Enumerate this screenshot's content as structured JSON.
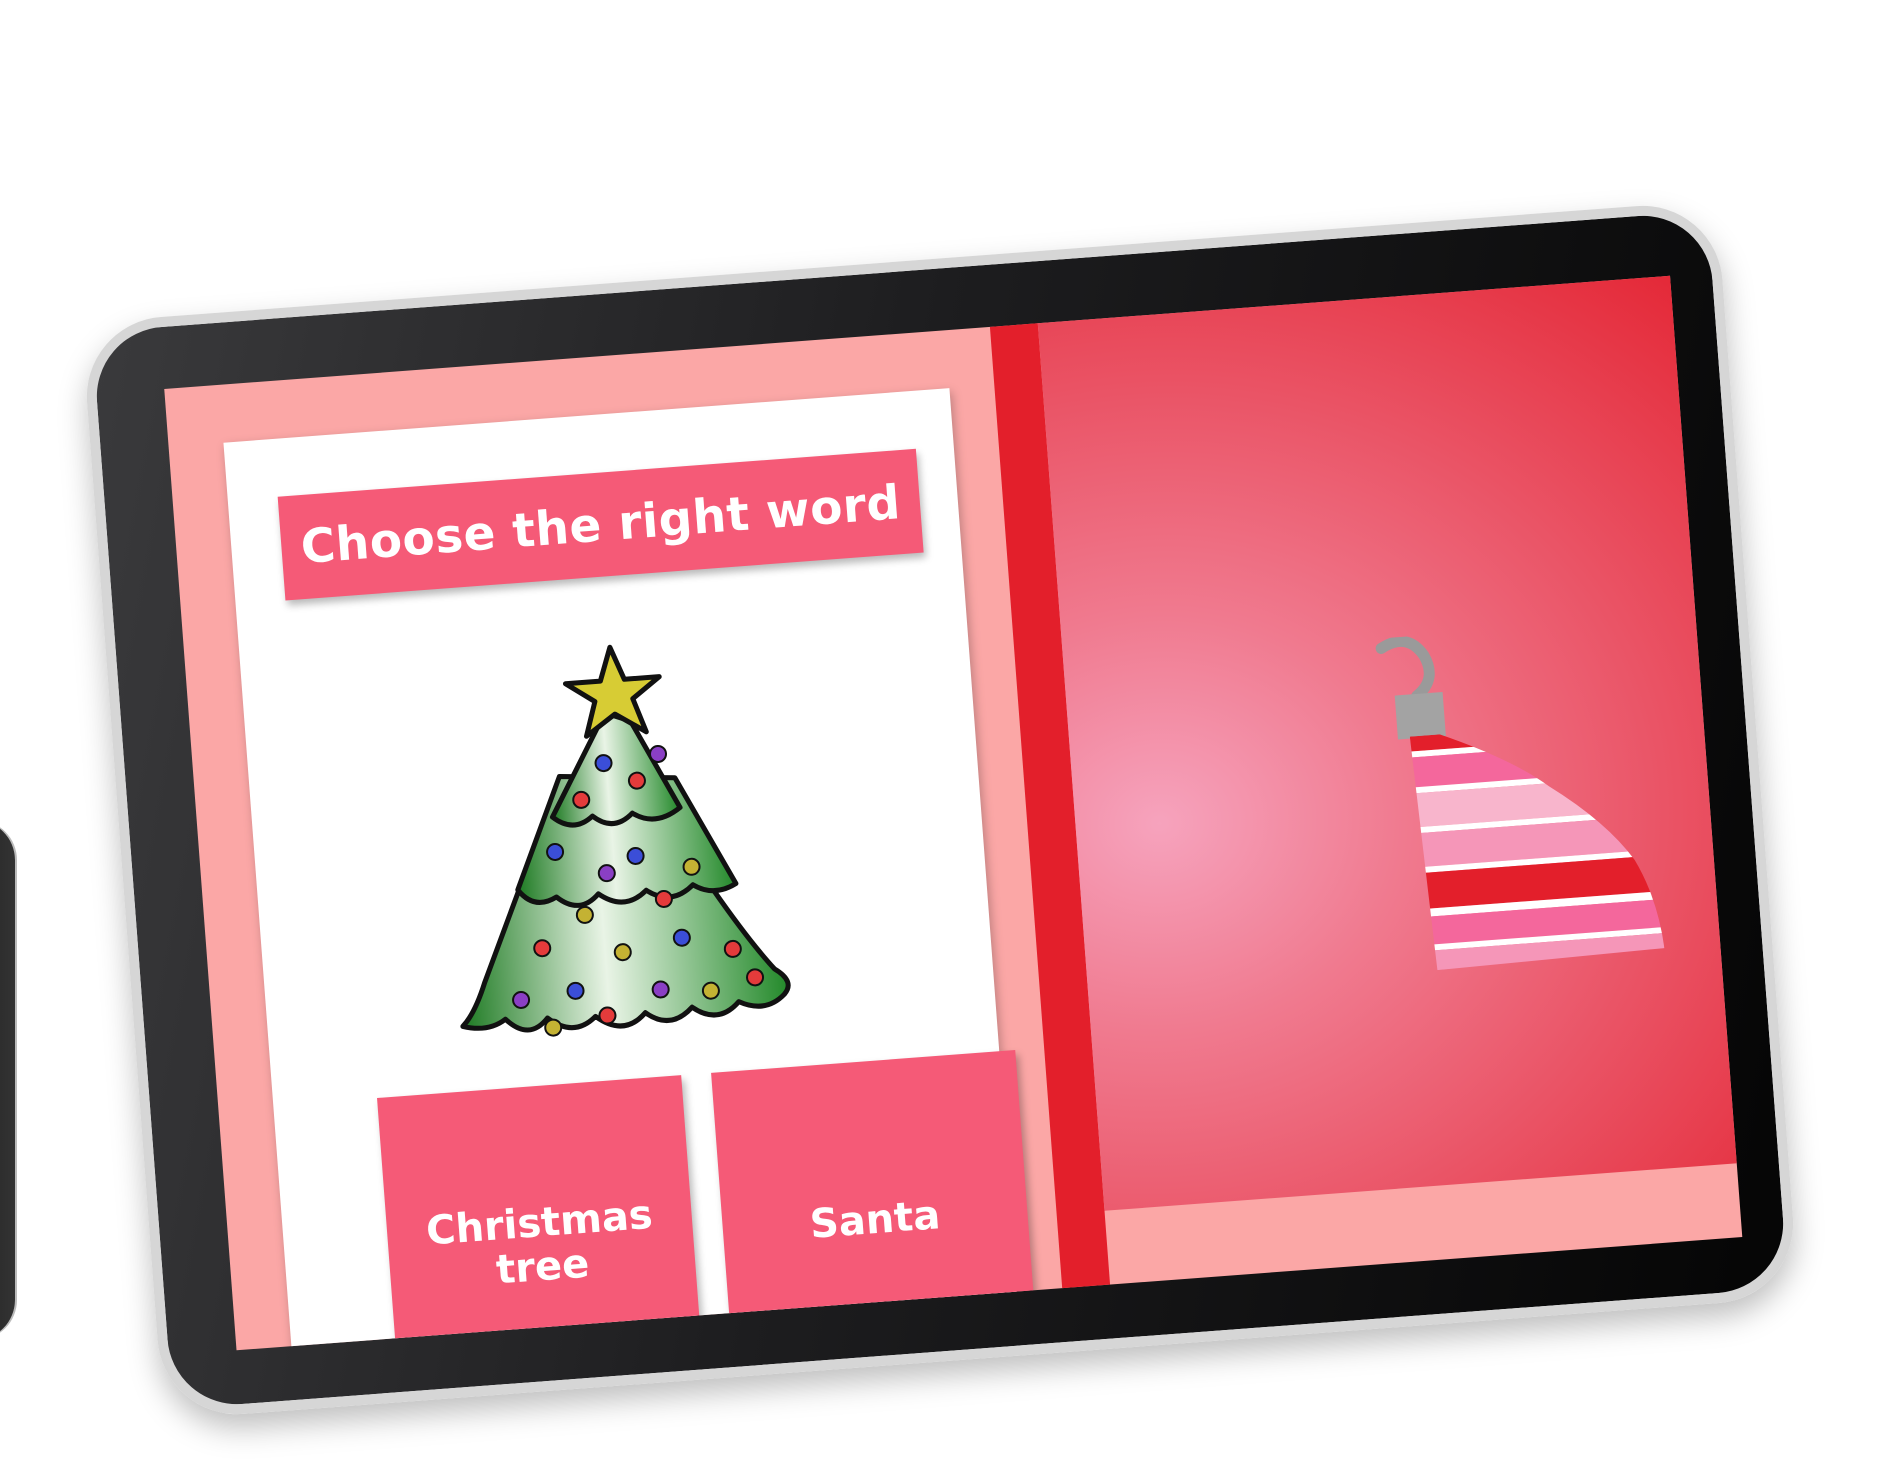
{
  "activity": {
    "title": "Choose the right word",
    "picture_icon": "christmas-tree-icon",
    "choices": [
      {
        "label_line1": "Christmas",
        "label_line2": "tree"
      },
      {
        "label_line1": "Santa",
        "label_line2": ""
      }
    ]
  },
  "side_panel": {
    "decoration_icon": "ornament-icon"
  },
  "colors": {
    "screen_background": "#fba7a6",
    "accent_pink": "#f55a77",
    "divider_red": "#e31f2b",
    "panel_red": "#e3202e"
  }
}
